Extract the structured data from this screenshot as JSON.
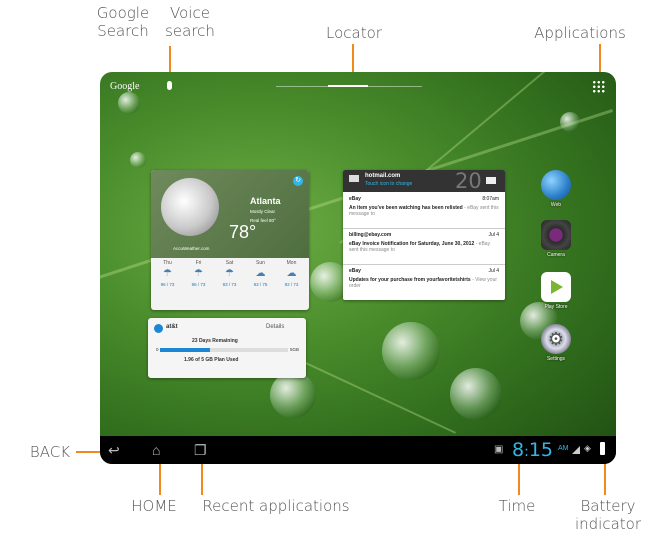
{
  "callouts": {
    "google_search": [
      "Google",
      "Search"
    ],
    "voice_search": [
      "Voice",
      "search"
    ],
    "locator": "Locator",
    "applications": "Applications",
    "back": "BACK",
    "home": "HOME",
    "recent_apps": "Recent applications",
    "time": "Time",
    "battery": [
      "Battery",
      "indicator"
    ]
  },
  "colors": {
    "callout_line": "#f08a1c",
    "clock": "#33b5e5"
  },
  "topbar": {
    "google_label": "Google"
  },
  "weather": {
    "city": "Atlanta",
    "condition": "Mostly Clear",
    "feels_like": "Real feel 80°",
    "temp": "78°",
    "provider": "AccuWeather.com",
    "forecast": [
      {
        "day": "Thu",
        "temps": "96 / 73"
      },
      {
        "day": "Fri",
        "temps": "96 / 73"
      },
      {
        "day": "Sat",
        "temps": "93 / 73"
      },
      {
        "day": "Sun",
        "temps": "93 / 75"
      },
      {
        "day": "Mon",
        "temps": "92 / 73"
      }
    ]
  },
  "email": {
    "account": "hotmail.com",
    "subtitle": "Touch icon to change",
    "count": "20",
    "items": [
      {
        "from": "eBay",
        "time": "8:07am",
        "subject": "An item you've been watching has been relisted",
        "preview": "- eBay sent this message to"
      },
      {
        "from": "billing@ebay.com",
        "time": "Jul 4",
        "subject": "eBay Invoice Notification for Saturday, June 30, 2012",
        "preview": "- eBay sent this message to"
      },
      {
        "from": "eBay",
        "time": "Jul 4",
        "subject": "Updates for your purchase from yourfavoritetshirts",
        "preview": "- View your order"
      }
    ]
  },
  "att": {
    "brand": "at&t",
    "details": "Details",
    "days_remaining": "23 Days Remaining",
    "min": "0",
    "max": "5GB",
    "usage": "1.96 of 5 GB Plan Used",
    "usage_fraction": 0.39
  },
  "apps": [
    {
      "label": "Web",
      "icon": "globe-icon"
    },
    {
      "label": "Camera",
      "icon": "camera-icon"
    },
    {
      "label": "Play Store",
      "icon": "play-store-icon"
    },
    {
      "label": "Settings",
      "icon": "gear-icon"
    }
  ],
  "status": {
    "hour": "8",
    "minutes": "15",
    "ampm": "AM"
  }
}
